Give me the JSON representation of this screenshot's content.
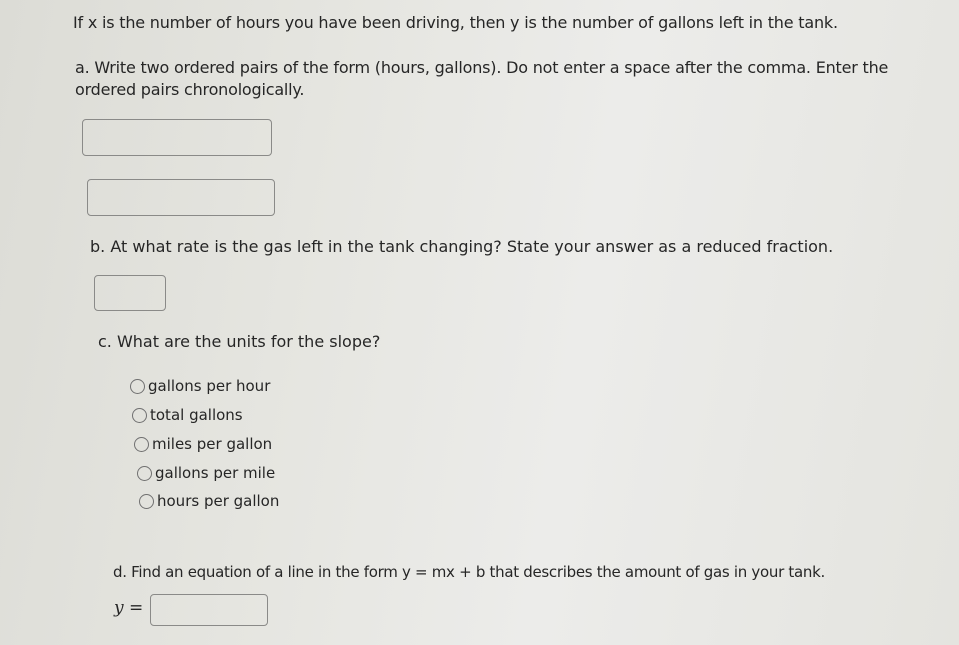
{
  "problem": {
    "intro": "If x is the number of hours you have been driving, then y is the number of gallons left in the tank.",
    "part_a": {
      "prompt": "a. Write two ordered pairs of the form (hours, gallons). Do not enter a space after the comma. Enter the ordered pairs chronologically.",
      "answer_1": "",
      "answer_2": ""
    },
    "part_b": {
      "prompt": "b. At what rate is the gas left in the tank changing? State your answer as a reduced fraction.",
      "answer": ""
    },
    "part_c": {
      "prompt": "c. What are the units for the slope?",
      "options": [
        {
          "label": "gallons per hour",
          "selected": false
        },
        {
          "label": "total gallons",
          "selected": false
        },
        {
          "label": "miles per gallon",
          "selected": false
        },
        {
          "label": "gallons per mile",
          "selected": false
        },
        {
          "label": "hours per gallon",
          "selected": false
        }
      ]
    },
    "part_d": {
      "prompt": "d. Find an equation of a line in the form y = mx + b that describes the amount of gas in your tank.",
      "equation_label": "y =",
      "answer": ""
    }
  }
}
